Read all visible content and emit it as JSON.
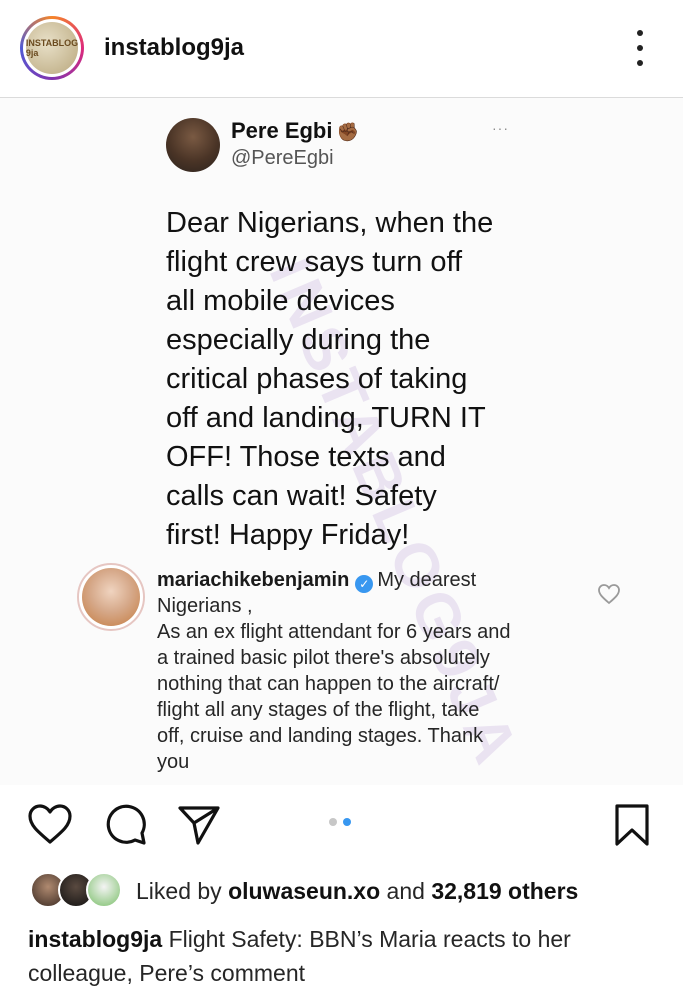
{
  "header": {
    "username": "instablog9ja",
    "avatar_label": "INSTABLOG 9ja",
    "more_icon": "more-vertical-icon"
  },
  "tweet": {
    "name": "Pere Egbi",
    "emoji": "✊🏾",
    "handle": "@PereEgbi",
    "more": "···",
    "text_lines": [
      "Dear Nigerians, when the",
      "flight crew says turn off",
      "all mobile devices",
      "especially during the",
      "critical phases of taking",
      "off and landing, TURN IT",
      "OFF! Those texts and",
      "calls can wait! Safety",
      "first! Happy Friday!"
    ],
    "watermark": "INSTABLOG9JA"
  },
  "comment": {
    "username": "mariachikebenjamin",
    "verified_icon": "verified-badge-icon",
    "text_first": "My dearest",
    "text_lines": [
      "Nigerians ,",
      "As an ex flight attendant for 6 years and",
      "a trained basic pilot there's absolutely",
      "nothing that can happen to the aircraft/",
      "flight all any stages of the flight, take",
      "off, cruise and landing stages. Thank",
      "you"
    ],
    "heart_icon": "heart-outline-icon"
  },
  "actions": {
    "like_icon": "heart-icon",
    "comment_icon": "comment-icon",
    "share_icon": "send-icon",
    "save_icon": "bookmark-icon",
    "carousel_total": 2,
    "carousel_active": 2
  },
  "likes": {
    "prefix": "Liked by ",
    "user": "oluwaseun.xo",
    "middle": " and ",
    "count": "32,819 others"
  },
  "caption": {
    "username": "instablog9ja",
    "text": " Flight Safety: BBN’s Maria reacts to her colleague, Pere’s comment"
  },
  "colors": {
    "accent_blue": "#3897f0",
    "text": "#262626"
  }
}
